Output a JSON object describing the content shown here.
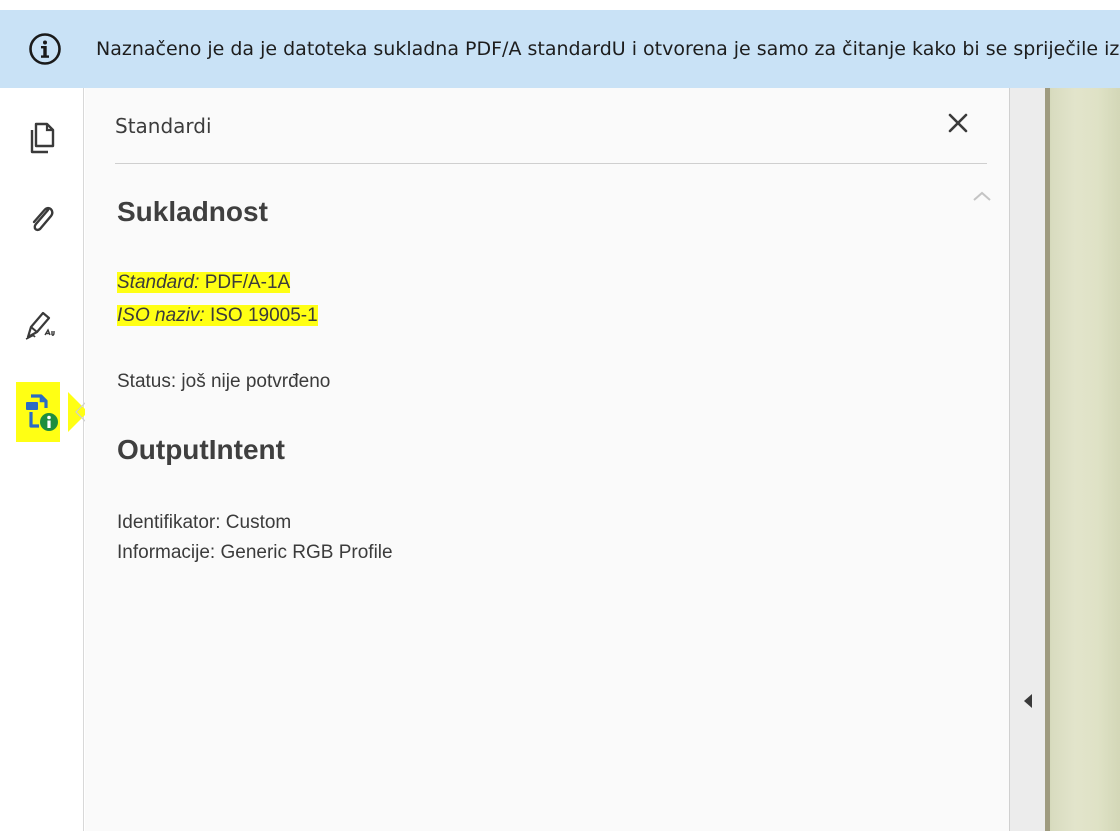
{
  "notification": {
    "text": "Naznačeno je da je datoteka sukladna PDF/A standardU i otvorena je samo za čitanje kako bi se spriječile izmjene."
  },
  "toolbar": {
    "tools": [
      {
        "name": "pages",
        "icon": "pages-icon"
      },
      {
        "name": "attachments",
        "icon": "paperclip-icon"
      },
      {
        "name": "signatures",
        "icon": "signature-pen-icon"
      },
      {
        "name": "standards",
        "icon": "standards-info-icon",
        "active": true
      }
    ]
  },
  "panel": {
    "title": "Standardi",
    "compliance": {
      "heading": "Sukladnost",
      "standard_label": "Standard:",
      "standard_value": "PDF/A-1A",
      "iso_label": "ISO naziv:",
      "iso_value": "ISO 19005-1",
      "status": "Status: još nije potvrđeno"
    },
    "output_intent": {
      "heading": "OutputIntent",
      "identifier": "Identifikator: Custom",
      "info": "Informacije: Generic RGB Profile"
    }
  },
  "colors": {
    "info_bar": "#c9e2f6",
    "highlight": "#ffff14",
    "panel_bg": "#fafafa",
    "icon_blue": "#2a6bc4",
    "icon_green": "#1e8e3e"
  }
}
